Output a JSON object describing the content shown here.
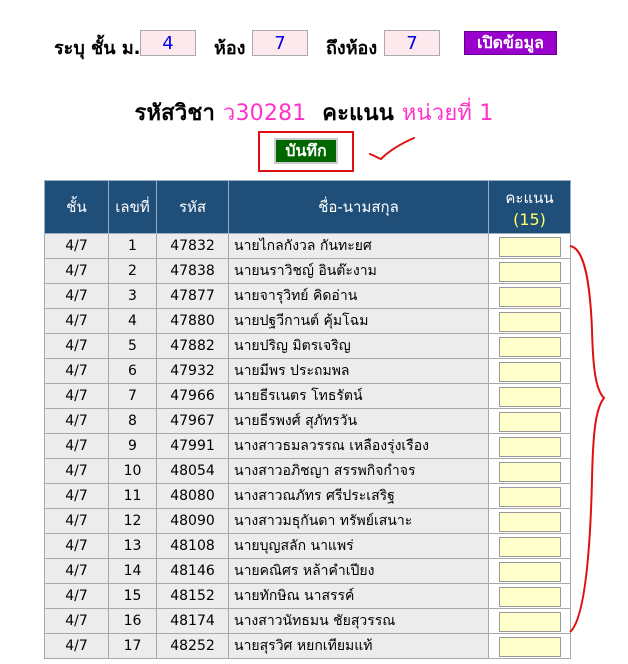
{
  "filter": {
    "level_label": "ระบุ ชั้น ม.",
    "level_value": "4",
    "room_label": "ห้อง",
    "room_value": "7",
    "to_room_label": "ถึงห้อง",
    "to_room_value": "7",
    "open_button": "เปิดข้อมูล"
  },
  "heading": {
    "subject_label": "รหัสวิชา",
    "subject_code": "ว30281",
    "score_label": "คะแนน",
    "unit": "หน่วยที่ 1"
  },
  "save_button": "บันทึก",
  "table": {
    "headers": {
      "class": "ชั้น",
      "number": "เลขที่",
      "id": "รหัส",
      "name": "ชื่อ-นามสกุล",
      "score": "คะแนน",
      "score_max": "(15)"
    },
    "rows": [
      {
        "cls": "4/7",
        "no": "1",
        "id": "47832",
        "name": "นายไกลกังวล กันทะยศ"
      },
      {
        "cls": "4/7",
        "no": "2",
        "id": "47838",
        "name": "นายนราวิชญ์ อินต๊ะงาม"
      },
      {
        "cls": "4/7",
        "no": "3",
        "id": "47877",
        "name": "นายจารุวิทย์ คิดอ่าน"
      },
      {
        "cls": "4/7",
        "no": "4",
        "id": "47880",
        "name": "นายปฐวีกานต์ คุ้มโฉม"
      },
      {
        "cls": "4/7",
        "no": "5",
        "id": "47882",
        "name": "นายปริญ มิตรเจริญ"
      },
      {
        "cls": "4/7",
        "no": "6",
        "id": "47932",
        "name": "นายมีพร ประถมพล"
      },
      {
        "cls": "4/7",
        "no": "7",
        "id": "47966",
        "name": "นายธีรเนตร โทธรัตน์"
      },
      {
        "cls": "4/7",
        "no": "8",
        "id": "47967",
        "name": "นายธีรพงศ์ สุภัทรวัน"
      },
      {
        "cls": "4/7",
        "no": "9",
        "id": "47991",
        "name": "นางสาวธมลวรรณ เหลืองรุ่งเรือง"
      },
      {
        "cls": "4/7",
        "no": "10",
        "id": "48054",
        "name": "นางสาวอภิชญา สรรพกิจกำจร"
      },
      {
        "cls": "4/7",
        "no": "11",
        "id": "48080",
        "name": "นางสาวณภัทร ศรีประเสริฐ"
      },
      {
        "cls": "4/7",
        "no": "12",
        "id": "48090",
        "name": "นางสาวมธุกันดา ทรัพย์เสนาะ"
      },
      {
        "cls": "4/7",
        "no": "13",
        "id": "48108",
        "name": "นายบุญสลัก นาแพร่"
      },
      {
        "cls": "4/7",
        "no": "14",
        "id": "48146",
        "name": "นายคณิศร หล้าคำเปียง"
      },
      {
        "cls": "4/7",
        "no": "15",
        "id": "48152",
        "name": "นายทักษิณ นาสรรค์"
      },
      {
        "cls": "4/7",
        "no": "16",
        "id": "48174",
        "name": "นางสาวนัทธมน ชัยสุวรรณ"
      },
      {
        "cls": "4/7",
        "no": "17",
        "id": "48252",
        "name": "นายสุรวิศ หยกเทียมแท้"
      }
    ]
  },
  "colors": {
    "header_bg": "#1f4e79",
    "open_button_bg": "#9900cc",
    "save_button_bg": "#006600",
    "annotation_red": "#e01010",
    "highlight_pink": "#ff33cc"
  }
}
